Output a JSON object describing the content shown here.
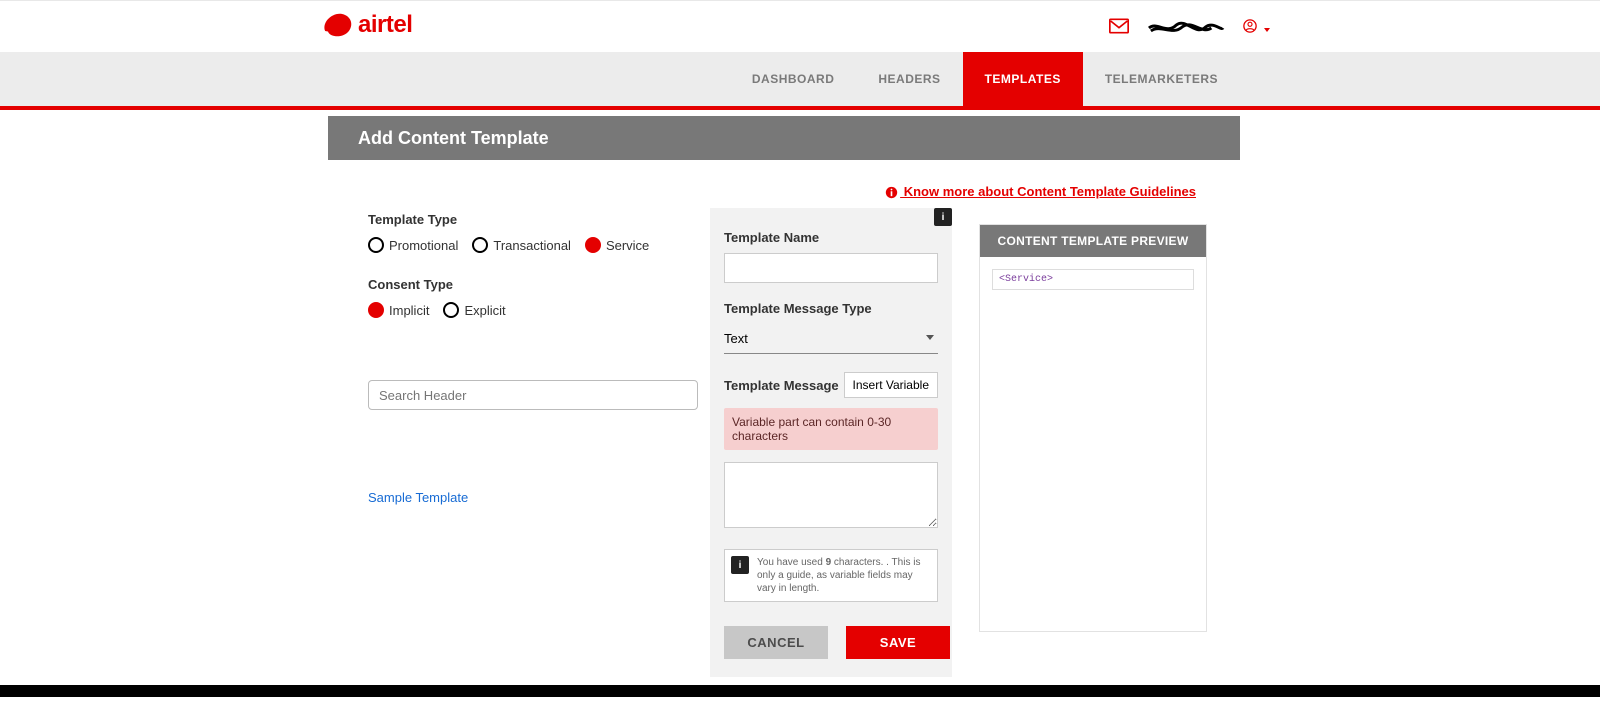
{
  "brand": {
    "name": "airtel"
  },
  "nav": {
    "items": [
      {
        "label": "DASHBOARD",
        "active": false
      },
      {
        "label": "HEADERS",
        "active": false
      },
      {
        "label": "TEMPLATES",
        "active": true
      },
      {
        "label": "TELEMARKETERS",
        "active": false
      }
    ]
  },
  "page_title": "Add Content Template",
  "know_more": " Know more about Content Template Guidelines",
  "template_type": {
    "label": "Template Type",
    "options": [
      {
        "label": "Promotional",
        "selected": false
      },
      {
        "label": "Transactional",
        "selected": false
      },
      {
        "label": "Service",
        "selected": true
      }
    ]
  },
  "consent_type": {
    "label": "Consent Type",
    "options": [
      {
        "label": "Implicit",
        "selected": true
      },
      {
        "label": "Explicit",
        "selected": false
      }
    ]
  },
  "search_header_placeholder": "Search Header",
  "sample_template_link": "Sample Template",
  "template_name": {
    "label": "Template Name",
    "value": ""
  },
  "template_message_type": {
    "label": "Template Message Type",
    "value": "Text"
  },
  "template_message": {
    "label": "Template Message",
    "insert_variable_btn": "Insert Variable",
    "variable_note": "Variable part can contain 0-30 characters",
    "value": ""
  },
  "char_count_note": {
    "prefix": "You have used ",
    "count": "9",
    "suffix": " characters. . This is only a guide, as variable fields may vary in length."
  },
  "buttons": {
    "cancel": "CANCEL",
    "save": "SAVE"
  },
  "preview": {
    "title": "CONTENT TEMPLATE PREVIEW",
    "tag": "<Service>"
  }
}
